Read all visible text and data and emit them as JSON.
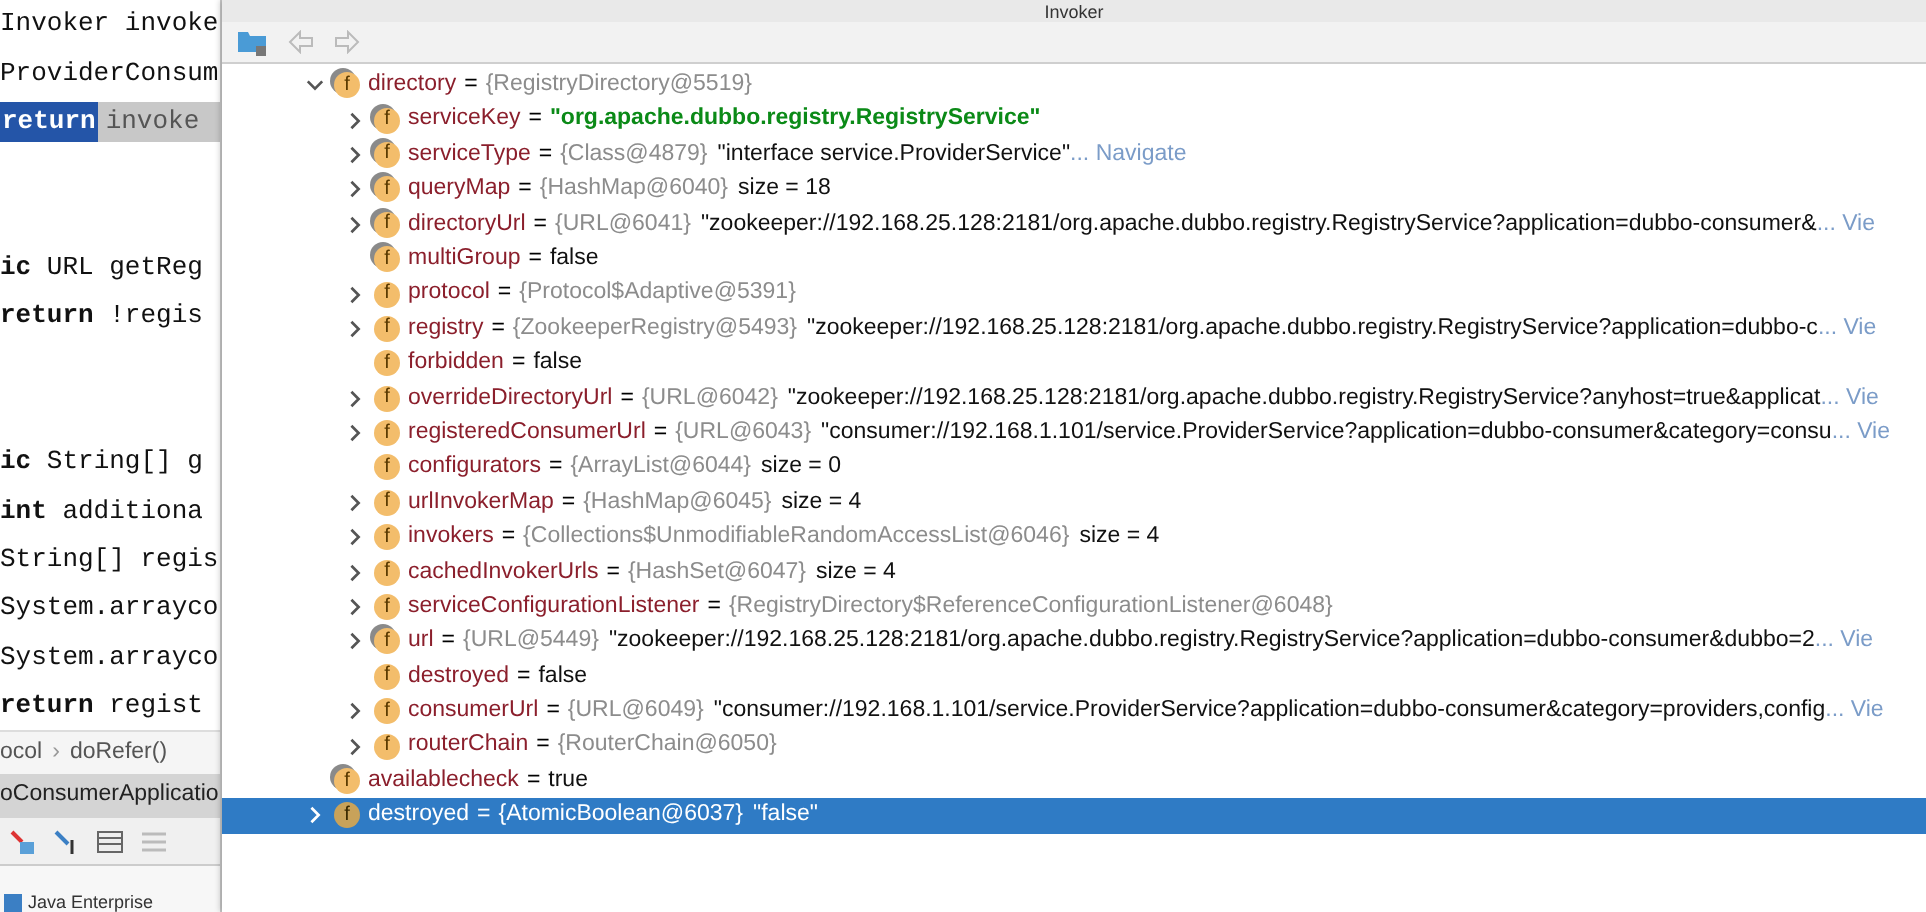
{
  "editor": {
    "lines": [
      {
        "kind": "code",
        "text": "Invoker invoke"
      },
      {
        "kind": "code",
        "text": "ProviderConsum"
      },
      {
        "kind": "selection",
        "highlight": "return",
        "selection": "invoke"
      },
      {
        "kind": "blank"
      },
      {
        "kind": "blank"
      },
      {
        "kind": "code",
        "text": "**ic** URL getReg"
      },
      {
        "kind": "code",
        "text": "**return** !regis"
      },
      {
        "kind": "blank"
      },
      {
        "kind": "blank"
      },
      {
        "kind": "code",
        "text": "**ic** String[] g"
      },
      {
        "kind": "code",
        "text": "**int** additiona"
      },
      {
        "kind": "code",
        "text": "String[] regis"
      },
      {
        "kind": "code",
        "text": "System.arrayco"
      },
      {
        "kind": "code",
        "text": "System.arrayco"
      },
      {
        "kind": "code",
        "text": "**return** regist"
      }
    ],
    "breadcrumb": [
      "ocol",
      "doRefer()"
    ],
    "breadcrumb_separator": "›",
    "tab": "oConsumerApplicatio",
    "bottom_item": "Java Enterprise"
  },
  "popup": {
    "title": "Invoker",
    "back_enabled": false,
    "forward_enabled": false,
    "tree": [
      {
        "icon": "f",
        "marked": true,
        "expanded": true,
        "selected": false,
        "name": "directory",
        "operator": "=",
        "ref": "{RegistryDirectory@5519}",
        "children": [
          {
            "kind": "string",
            "icon": "f",
            "marked": true,
            "expanded": false,
            "selected": false,
            "name": "serviceKey",
            "operator": "=",
            "value": "\"org.apache.dubbo.registry.RegistryService\""
          },
          {
            "kind": "object",
            "icon": "f",
            "marked": true,
            "expanded": false,
            "selected": false,
            "name": "serviceType",
            "operator": "=",
            "ref": "{Class@4879}",
            "value": "\"interface service.ProviderService\"",
            "link": "... Navigate"
          },
          {
            "kind": "object",
            "icon": "f",
            "marked": true,
            "expanded": false,
            "selected": false,
            "name": "queryMap",
            "operator": "=",
            "ref": "{HashMap@6040}",
            "value": "size = 18"
          },
          {
            "kind": "object",
            "icon": "f",
            "marked": true,
            "expanded": false,
            "selected": false,
            "name": "directoryUrl",
            "operator": "=",
            "ref": "{URL@6041}",
            "value": "\"zookeeper://192.168.25.128:2181/org.apache.dubbo.registry.RegistryService?application=dubbo-consumer&",
            "link": "... Vie"
          },
          {
            "kind": "object",
            "icon": "f",
            "marked": true,
            "selected": false,
            "name": "multiGroup",
            "operator": "=",
            "value": "false"
          },
          {
            "icon": "f",
            "marked": false,
            "expanded": false,
            "selected": false,
            "name": "protocol",
            "operator": "=",
            "ref": "{Protocol$Adaptive@5391}"
          },
          {
            "kind": "object",
            "icon": "f",
            "marked": false,
            "expanded": false,
            "selected": false,
            "name": "registry",
            "operator": "=",
            "ref": "{ZookeeperRegistry@5493}",
            "value": "\"zookeeper://192.168.25.128:2181/org.apache.dubbo.registry.RegistryService?application=dubbo-c",
            "link": "... Vie"
          },
          {
            "kind": "object",
            "icon": "f",
            "marked": false,
            "selected": false,
            "name": "forbidden",
            "operator": "=",
            "value": "false"
          },
          {
            "kind": "object",
            "icon": "f",
            "marked": false,
            "expanded": false,
            "selected": false,
            "name": "overrideDirectoryUrl",
            "operator": "=",
            "ref": "{URL@6042}",
            "value": "\"zookeeper://192.168.25.128:2181/org.apache.dubbo.registry.RegistryService?anyhost=true&applicat",
            "link": "... Vie"
          },
          {
            "kind": "object",
            "icon": "f",
            "marked": false,
            "expanded": false,
            "selected": false,
            "name": "registeredConsumerUrl",
            "operator": "=",
            "ref": "{URL@6043}",
            "value": "\"consumer://192.168.1.101/service.ProviderService?application=dubbo-consumer&category=consu",
            "link": "... Vie"
          },
          {
            "kind": "object",
            "icon": "f",
            "marked": false,
            "selected": false,
            "name": "configurators",
            "operator": "=",
            "ref": "{ArrayList@6044}",
            "value": "size = 0"
          },
          {
            "kind": "object",
            "icon": "f",
            "marked": false,
            "expanded": false,
            "selected": false,
            "name": "urlInvokerMap",
            "operator": "=",
            "ref": "{HashMap@6045}",
            "value": "size = 4"
          },
          {
            "kind": "object",
            "icon": "f",
            "marked": false,
            "expanded": false,
            "selected": false,
            "name": "invokers",
            "operator": "=",
            "ref": "{Collections$UnmodifiableRandomAccessList@6046}",
            "value": "size = 4"
          },
          {
            "kind": "object",
            "icon": "f",
            "marked": false,
            "expanded": false,
            "selected": false,
            "name": "cachedInvokerUrls",
            "operator": "=",
            "ref": "{HashSet@6047}",
            "value": "size = 4"
          },
          {
            "icon": "f",
            "marked": false,
            "expanded": false,
            "selected": false,
            "name": "serviceConfigurationListener",
            "operator": "=",
            "ref": "{RegistryDirectory$ReferenceConfigurationListener@6048}"
          },
          {
            "kind": "object",
            "icon": "f",
            "marked": true,
            "expanded": false,
            "selected": false,
            "name": "url",
            "operator": "=",
            "ref": "{URL@5449}",
            "value": "\"zookeeper://192.168.25.128:2181/org.apache.dubbo.registry.RegistryService?application=dubbo-consumer&dubbo=2",
            "link": "... Vie"
          },
          {
            "kind": "object",
            "icon": "f",
            "marked": false,
            "selected": false,
            "name": "destroyed",
            "operator": "=",
            "value": "false"
          },
          {
            "kind": "object",
            "icon": "f",
            "marked": false,
            "expanded": false,
            "selected": false,
            "name": "consumerUrl",
            "operator": "=",
            "ref": "{URL@6049}",
            "value": "\"consumer://192.168.1.101/service.ProviderService?application=dubbo-consumer&category=providers,config",
            "link": "... Vie"
          },
          {
            "icon": "f",
            "marked": false,
            "expanded": false,
            "selected": false,
            "name": "routerChain",
            "operator": "=",
            "ref": "{RouterChain@6050}"
          }
        ]
      },
      {
        "kind": "object",
        "icon": "f",
        "marked": true,
        "selected": false,
        "name": "availablecheck",
        "operator": "=",
        "value": "true"
      },
      {
        "kind": "object",
        "icon": "f",
        "marked": false,
        "expanded": false,
        "selected": true,
        "name": "destroyed",
        "operator": "=",
        "ref": "{AtomicBoolean@6037}",
        "value": "\"false\""
      }
    ]
  }
}
